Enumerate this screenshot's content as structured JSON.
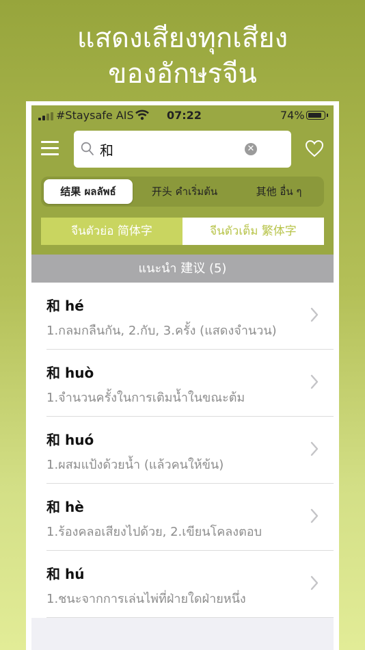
{
  "banner": {
    "line1": "แสดงเสียงทุกเสียง",
    "line2": "ของอักษรจีน"
  },
  "status_bar": {
    "carrier": "#Staysafe AIS",
    "time": "07:22",
    "battery": "74%"
  },
  "search": {
    "value": "和"
  },
  "segments": [
    {
      "label": "结果 ผลลัพธ์",
      "selected": true
    },
    {
      "label": "开头 คำเริ่มต้น",
      "selected": false
    },
    {
      "label": "其他  อื่น ๆ",
      "selected": false
    }
  ],
  "script_toggle": {
    "simplified": "จีนตัวย่อ 简体字",
    "traditional": "จีนตัวเต็ม 繁体字"
  },
  "section": {
    "title": "แนะนำ 建议 (5)"
  },
  "results": [
    {
      "word": "和 hé",
      "definition": "1.กลมกลืนกัน, 2.กับ, 3.ครั้ง (แสดงจำนวน)"
    },
    {
      "word": "和 huò",
      "definition": "1.จำนวนครั้งในการเติมน้ำในขณะต้ม"
    },
    {
      "word": "和 huó",
      "definition": "1.ผสมแป้งด้วยน้ำ (แล้วคนให้ข้น)"
    },
    {
      "word": "和 hè",
      "definition": "1.ร้องคลอเสียงไปด้วย, 2.เขียนโคลงตอบ"
    },
    {
      "word": "和 hú",
      "definition": "1.ชนะจากการเล่นไพ่ที่ฝ่ายใดฝ่ายหนึ่ง"
    }
  ],
  "colors": {
    "accent": "#9aa843",
    "toggle_active": "#c9d560",
    "section_header": "#a9a9ab"
  },
  "icons": [
    "menu-icon",
    "search-icon",
    "clear-icon",
    "heart-icon",
    "chevron-right-icon",
    "wifi-icon",
    "battery-icon",
    "signal-icon"
  ]
}
